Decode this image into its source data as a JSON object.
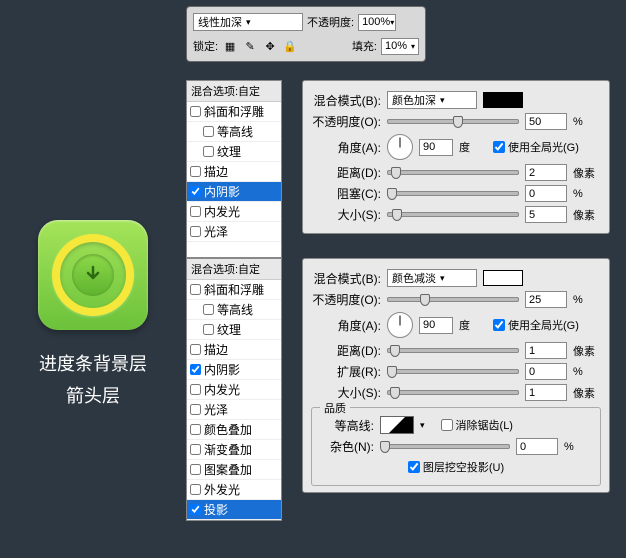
{
  "left": {
    "label1": "进度条背景层",
    "label2": "箭头层"
  },
  "top": {
    "blend_mode": "线性加深",
    "opacity_label": "不透明度:",
    "opacity": "100%",
    "lock_label": "锁定:",
    "fill_label": "填充:",
    "fill": "10%"
  },
  "list1": {
    "head": "混合选项:自定",
    "items": [
      {
        "label": "斜面和浮雕",
        "chk": false
      },
      {
        "label": "等高线",
        "chk": false,
        "indent": true
      },
      {
        "label": "纹理",
        "chk": false,
        "indent": true
      },
      {
        "label": "描边",
        "chk": false
      },
      {
        "label": "内阴影",
        "chk": true,
        "sel": true
      },
      {
        "label": "内发光",
        "chk": false
      },
      {
        "label": "光泽",
        "chk": false
      }
    ]
  },
  "list2": {
    "head": "混合选项:自定",
    "items": [
      {
        "label": "斜面和浮雕",
        "chk": false
      },
      {
        "label": "等高线",
        "chk": false,
        "indent": true
      },
      {
        "label": "纹理",
        "chk": false,
        "indent": true
      },
      {
        "label": "描边",
        "chk": false
      },
      {
        "label": "内阴影",
        "chk": true
      },
      {
        "label": "内发光",
        "chk": false
      },
      {
        "label": "光泽",
        "chk": false
      },
      {
        "label": "颜色叠加",
        "chk": false
      },
      {
        "label": "渐变叠加",
        "chk": false
      },
      {
        "label": "图案叠加",
        "chk": false
      },
      {
        "label": "外发光",
        "chk": false
      },
      {
        "label": "投影",
        "chk": true,
        "sel": true
      }
    ]
  },
  "panel1": {
    "blend_label": "混合模式(B):",
    "blend_value": "颜色加深",
    "opacity_label": "不透明度(O):",
    "opacity": "50",
    "pct": "%",
    "angle_label": "角度(A):",
    "angle": "90",
    "deg": "度",
    "global": "使用全局光(G)",
    "distance_label": "距离(D):",
    "distance": "2",
    "px": "像素",
    "choke_label": "阻塞(C):",
    "choke": "0",
    "size_label": "大小(S):",
    "size": "5"
  },
  "panel2": {
    "blend_label": "混合模式(B):",
    "blend_value": "颜色减淡",
    "opacity_label": "不透明度(O):",
    "opacity": "25",
    "pct": "%",
    "angle_label": "角度(A):",
    "angle": "90",
    "deg": "度",
    "global": "使用全局光(G)",
    "distance_label": "距离(D):",
    "distance": "1",
    "px": "像素",
    "spread_label": "扩展(R):",
    "spread": "0",
    "size_label": "大小(S):",
    "size": "1",
    "quality_legend": "品质",
    "contour_label": "等高线:",
    "antialias": "消除锯齿(L)",
    "noise_label": "杂色(N):",
    "noise": "0",
    "knockout": "图层挖空投影(U)"
  }
}
